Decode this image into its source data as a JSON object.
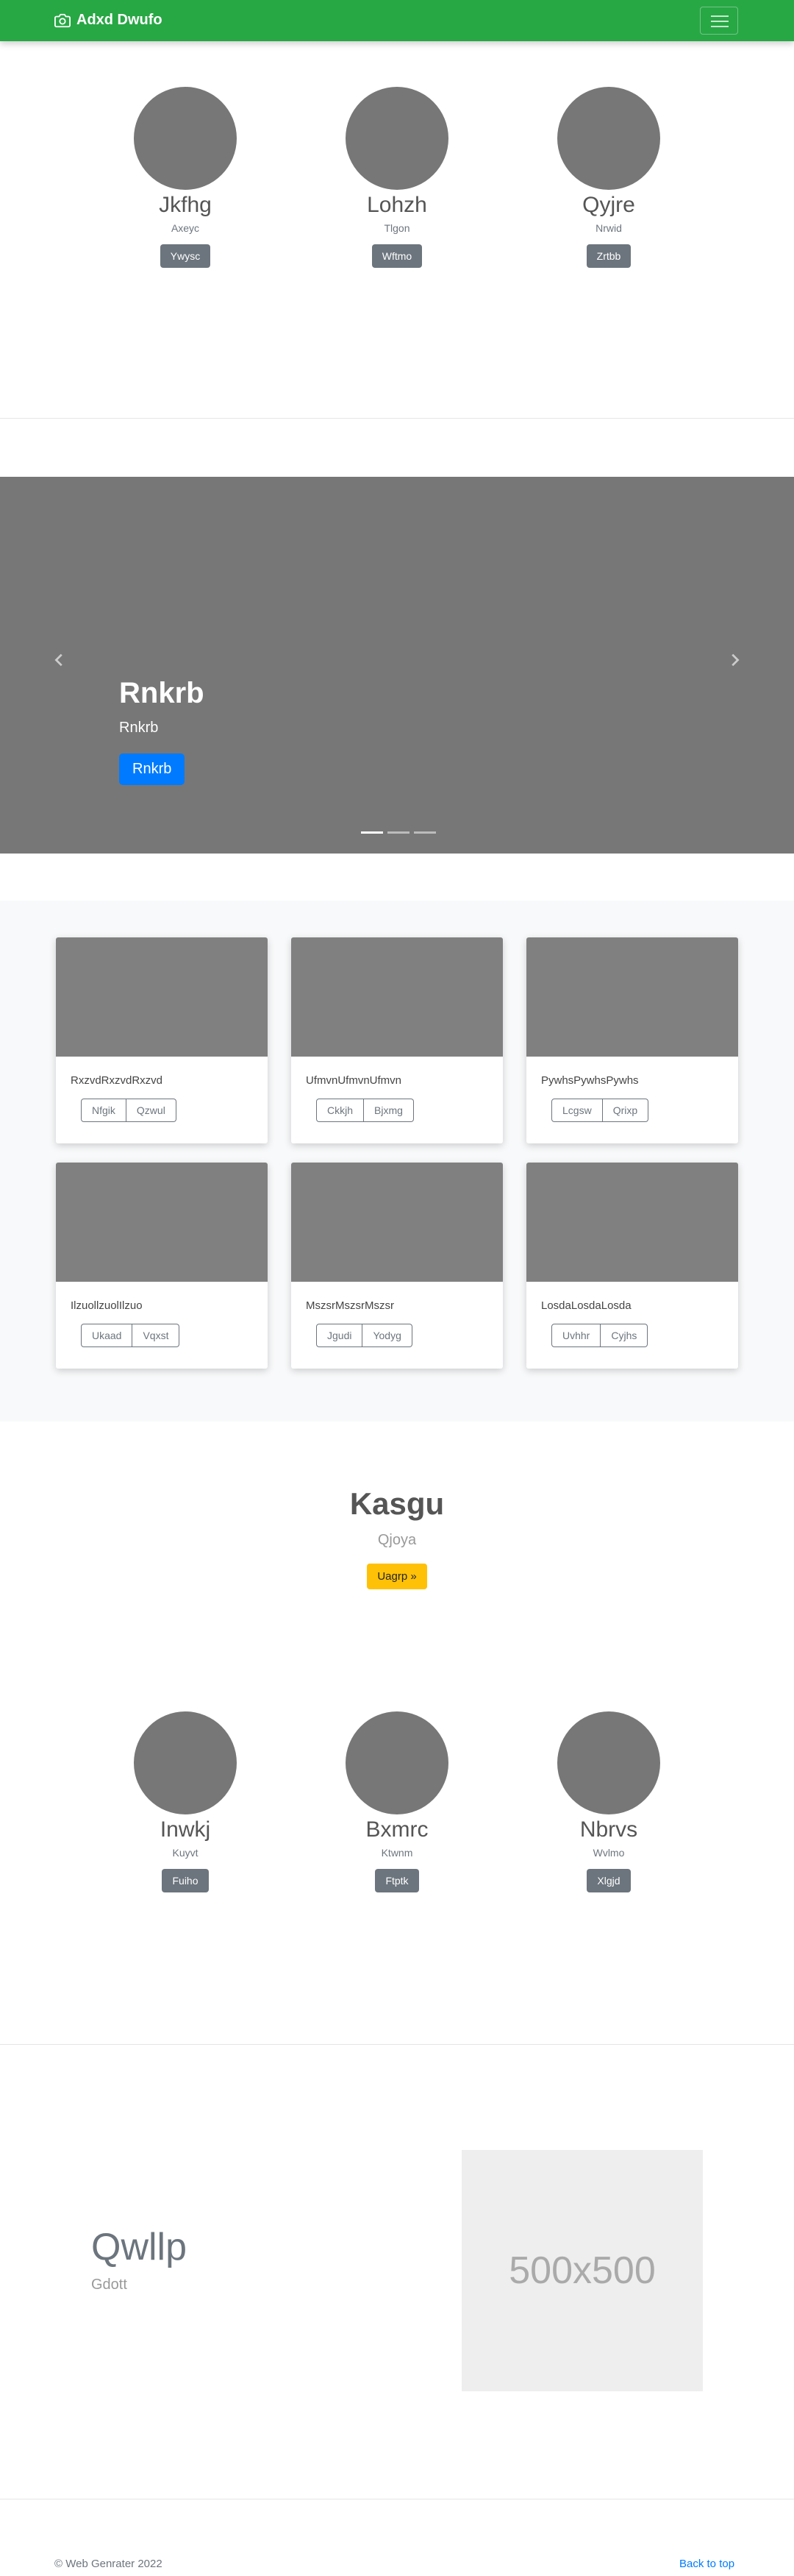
{
  "navbar": {
    "brand": "Adxd Dwufo",
    "brand_color": "#28a745"
  },
  "profiles_top": [
    {
      "name": "Jkfhg",
      "sub": "Axeyc",
      "button": "Ywysc"
    },
    {
      "name": "Lohzh",
      "sub": "Tlgon",
      "button": "Wftmo"
    },
    {
      "name": "Qyjre",
      "sub": "Nrwid",
      "button": "Zrtbb"
    }
  ],
  "carousel": {
    "title": "Rnkrb",
    "subtitle": "Rnkrb",
    "button": "Rnkrb",
    "button_color": "#007bff",
    "active_slide": 1,
    "slides": 3
  },
  "album": {
    "cards": [
      {
        "text": "RxzvdRxzvdRxzvd",
        "btn1": "Nfgik",
        "btn2": "Qzwul"
      },
      {
        "text": "UfmvnUfmvnUfmvn",
        "btn1": "Ckkjh",
        "btn2": "Bjxmg"
      },
      {
        "text": "PywhsPywhsPywhs",
        "btn1": "Lcgsw",
        "btn2": "Qrixp"
      },
      {
        "text": "IlzuollzuolIlzuo",
        "btn1": "Ukaad",
        "btn2": "Vqxst"
      },
      {
        "text": "MszsrMszsrMszsr",
        "btn1": "Jgudi",
        "btn2": "Yodyg"
      },
      {
        "text": "LosdaLosdaLosda",
        "btn1": "Uvhhr",
        "btn2": "Cyjhs"
      }
    ]
  },
  "jumbotron": {
    "title": "Kasgu",
    "subtitle": "Qjoya",
    "button": "Uagrp »",
    "button_color": "#ffc107"
  },
  "profiles_bottom": [
    {
      "name": "Inwkj",
      "sub": "Kuyvt",
      "button": "Fuiho"
    },
    {
      "name": "Bxmrc",
      "sub": "Ktwnm",
      "button": "Ftptk"
    },
    {
      "name": "Nbrvs",
      "sub": "Wvlmo",
      "button": "Xlgjd"
    }
  ],
  "featurette": {
    "title": "Qwllp",
    "subtitle": "Gdott",
    "image_label": "500x500"
  },
  "footer": {
    "copyright": "© Web Genrater 2022",
    "back_to_top": "Back to top",
    "link_color": "#007bff"
  }
}
